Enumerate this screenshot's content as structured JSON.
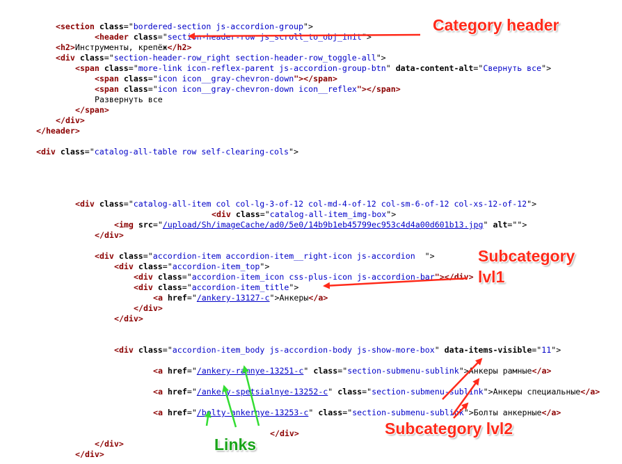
{
  "code": {
    "l1": [
      "<",
      "section",
      " ",
      "class",
      "=\"",
      "bordered-section js-accordion-group",
      "\">"
    ],
    "l2": [
      "<",
      "header",
      " ",
      "class",
      "=\"",
      "section-header-row js_scroll_to_obj_init",
      "\">"
    ],
    "l3": [
      "<",
      "h2",
      ">",
      "Инструменты, крепёж",
      "</",
      "h2",
      ">"
    ],
    "l4": [
      "<",
      "div",
      " ",
      "class",
      "=\"",
      "section-header-row_right section-header-row_toggle-all",
      "\">"
    ],
    "l5": [
      "<",
      "span",
      " ",
      "class",
      "=\"",
      "more-link icon-reflex-parent js-accordion-group-btn",
      "\" ",
      "data-content-alt",
      "=\"",
      "Свернуть все",
      "\">"
    ],
    "l6": [
      "<",
      "span",
      " ",
      "class",
      "=\"",
      "icon icon__gray-chevron-down",
      "\"></",
      "span",
      ">"
    ],
    "l7": [
      "<",
      "span",
      " ",
      "class",
      "=\"",
      "icon icon__gray-chevron-down icon__reflex",
      "\"></",
      "span",
      ">"
    ],
    "l8": [
      "Развернуть все"
    ],
    "l9": [
      "</",
      "span",
      ">"
    ],
    "l10": [
      "</",
      "div",
      ">"
    ],
    "l11": [
      "</",
      "header",
      ">"
    ],
    "l12": [
      "<",
      "div",
      " ",
      "class",
      "=\"",
      "catalog-all-table row self-clearing-cols",
      "\">"
    ],
    "l13": [
      "<",
      "div",
      " ",
      "class",
      "=\"",
      "catalog-all-item col col-lg-3-of-12 col-md-4-of-12 col-sm-6-of-12 col-xs-12-of-12",
      "\">"
    ],
    "l14": [
      "<",
      "div",
      " ",
      "class",
      "=\"",
      "catalog-all-item_img-box",
      "\">"
    ],
    "l15": [
      "<",
      "img",
      " ",
      "src",
      "=\"",
      "/upload/Sh/imageCache/ad0/5e0/14b9b1eb45799ec953c4d4a00d601b13.jpg",
      "\" ",
      "alt",
      "=\"\">"
    ],
    "l16": [
      "</",
      "div",
      ">"
    ],
    "l17": [
      "<",
      "div",
      " ",
      "class",
      "=\"",
      "accordion-item accordion-item__right-icon js-accordion  ",
      "\">"
    ],
    "l18": [
      "<",
      "div",
      " ",
      "class",
      "=\"",
      "accordion-item_top",
      "\">"
    ],
    "l19": [
      "<",
      "div",
      " ",
      "class",
      "=\"",
      "accordion-item_icon css-plus-icon js-accordion-bar",
      "\"></",
      "div",
      ">"
    ],
    "l20": [
      "<",
      "div",
      " ",
      "class",
      "=\"",
      "accordion-item_title",
      "\">"
    ],
    "l21": [
      "<",
      "a",
      " ",
      "href",
      "=\"",
      "/ankery-13127-c",
      "\">",
      "Анкеры",
      "</",
      "a",
      ">"
    ],
    "l22": [
      "</",
      "div",
      ">"
    ],
    "l23": [
      "</",
      "div",
      ">"
    ],
    "l24": [
      "<",
      "div",
      " ",
      "class",
      "=\"",
      "accordion-item_body js-accordion-body js-show-more-box",
      "\" ",
      "data-items-visible",
      "=\"",
      "11",
      "\">"
    ],
    "l25": [
      "<",
      "a",
      " ",
      "href",
      "=\"",
      "/ankery-ramnye-13251-c",
      "\" ",
      "class",
      "=\"",
      "section-submenu-sublink",
      "\">",
      "Анкеры рамные",
      "</",
      "a",
      ">"
    ],
    "l26": [
      "<",
      "a",
      " ",
      "href",
      "=\"",
      "/ankery-spetsialnye-13252-c",
      "\" ",
      "class",
      "=\"",
      "section-submenu-sublink",
      "\">",
      "Анкеры специальные",
      "</",
      "a",
      ">"
    ],
    "l27": [
      "<",
      "a",
      " ",
      "href",
      "=\"",
      "/bolty-ankernye-13253-c",
      "\" ",
      "class",
      "=\"",
      "section-submenu-sublink",
      "\">",
      "Болты анкерные",
      "</",
      "a",
      ">"
    ],
    "l28": [
      "</",
      "div",
      ">"
    ],
    "l29": [
      "</",
      "div",
      ">"
    ],
    "l30": [
      "</",
      "div",
      ">"
    ]
  },
  "annotations": {
    "category_header": "Category header",
    "subcategory_lvl1_line1": "Subcategory",
    "subcategory_lvl1_line2": "lvl1",
    "subcategory_lvl2": "Subcategory lvl2",
    "links": "Links"
  },
  "colors": {
    "annotation_red": "#ff2a1a",
    "annotation_green": "#1aa41a",
    "tag": "#8b0000",
    "string": "#0000c8"
  }
}
